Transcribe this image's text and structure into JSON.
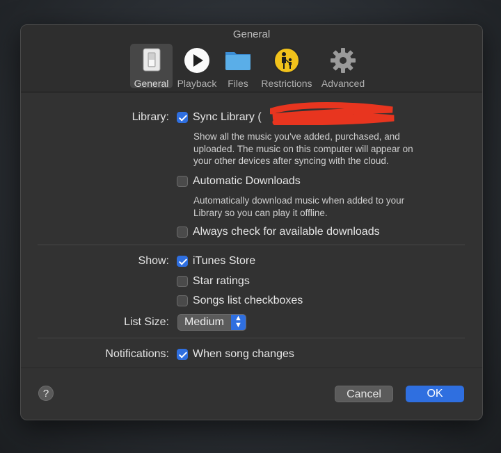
{
  "window": {
    "title": "General"
  },
  "tabs": [
    {
      "label": "General",
      "icon": "general-switch-icon",
      "active": true
    },
    {
      "label": "Playback",
      "icon": "play-icon"
    },
    {
      "label": "Files",
      "icon": "folder-icon"
    },
    {
      "label": "Restrictions",
      "icon": "parental-restrictions-icon"
    },
    {
      "label": "Advanced",
      "icon": "gear-icon"
    }
  ],
  "library": {
    "label": "Library:",
    "sync": {
      "label": "Sync Library (",
      "checked": true
    },
    "sync_desc": [
      "Show all the music you've added, purchased, and",
      "uploaded. The music on this computer will appear on",
      "your other devices after syncing with the cloud."
    ],
    "auto_downloads": {
      "label": "Automatic Downloads",
      "checked": false
    },
    "auto_desc": [
      "Automatically download music when added to your",
      "Library so you can play it offline."
    ],
    "always_check": {
      "label": "Always check for available downloads",
      "checked": false
    }
  },
  "show": {
    "label": "Show:",
    "itunes_store": {
      "label": "iTunes Store",
      "checked": true
    },
    "star_ratings": {
      "label": "Star ratings",
      "checked": false
    },
    "songs_checkboxes": {
      "label": "Songs list checkboxes",
      "checked": false
    }
  },
  "list_size": {
    "label": "List Size:",
    "value": "Medium"
  },
  "notifications": {
    "label": "Notifications:",
    "when_song_changes": {
      "label": "When song changes",
      "checked": true
    }
  },
  "footer": {
    "help": "?",
    "cancel": "Cancel",
    "ok": "OK"
  },
  "colors": {
    "accent": "#2f6fe0",
    "window_bg": "#323232",
    "redaction": "#e8351f"
  }
}
